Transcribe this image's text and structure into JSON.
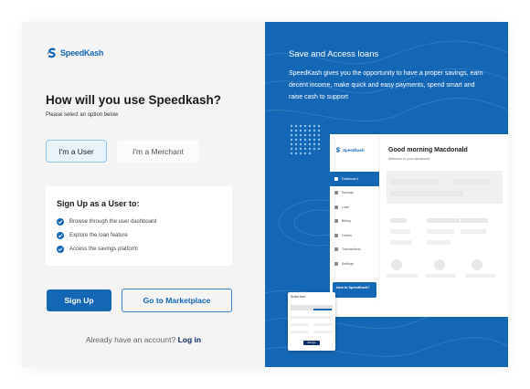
{
  "brand": {
    "name": "SpeedKash",
    "color": "#1467b4"
  },
  "left": {
    "heading": "How will you use Speedkash?",
    "subheading": "Please select an option below",
    "roles": {
      "user": "I'm a User",
      "merchant": "I'm a Merchant"
    },
    "info": {
      "title": "Sign Up as a User to:",
      "items": [
        "Browse through the user dashboard",
        "Explore the loan feature",
        "Access the savings platform"
      ]
    },
    "signup_label": "Sign Up",
    "marketplace_label": "Go to Marketplace",
    "login_prompt": "Already have an account?",
    "login_link": "Log in"
  },
  "right": {
    "title": "Save and Access loans",
    "description": "SpeedKash gives you the opportunity to have a proper savings, earn decent income, make quick and easy payments, spend smart and raise cash to support",
    "preview": {
      "logo": "Speedkash",
      "greeting": "Good morning Macdonald",
      "welcome": "Welcome to your dashboard",
      "nav": [
        "Dashboard",
        "Savings",
        "Loan",
        "Billing",
        "Orders",
        "Transactions",
        "Settings"
      ],
      "promo": "New to SpeedKash?",
      "mini_title": "Sched form",
      "mini_button": "Savings"
    }
  }
}
